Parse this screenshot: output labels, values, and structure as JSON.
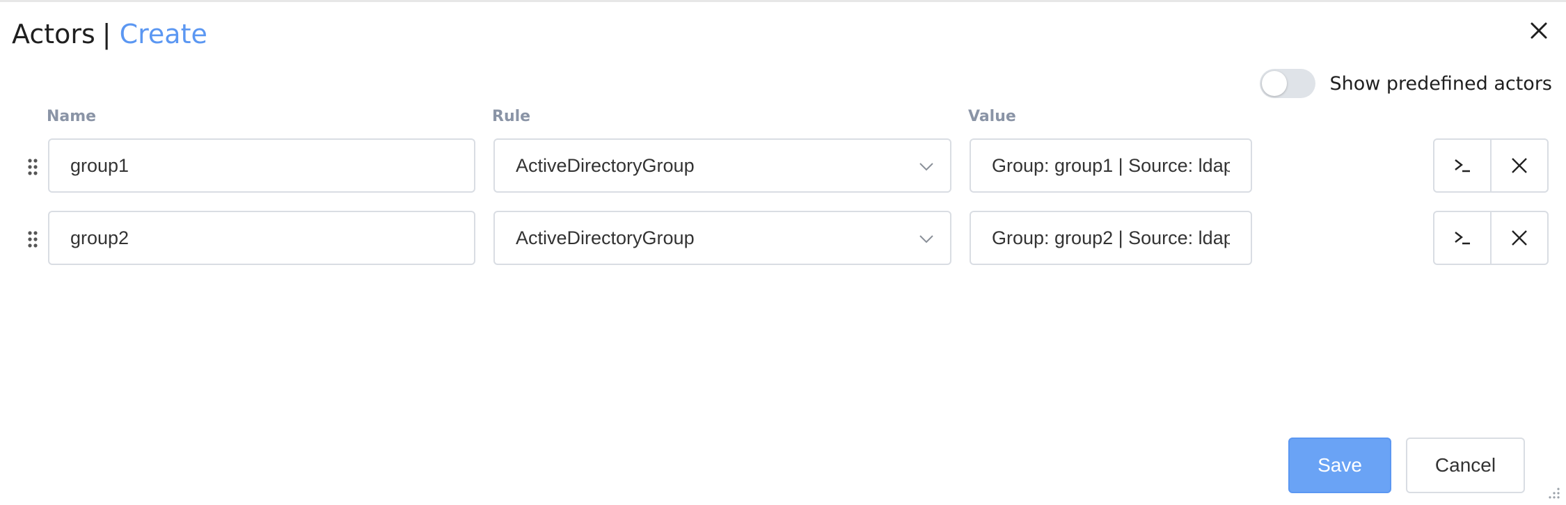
{
  "dialog": {
    "title_main": "Actors",
    "title_separator": "|",
    "title_action": "Create",
    "close_icon": "close-icon"
  },
  "toggle": {
    "label": "Show predefined actors",
    "checked": false
  },
  "columns": {
    "name": "Name",
    "rule": "Rule",
    "value": "Value"
  },
  "rows": [
    {
      "name": "group1",
      "rule": "ActiveDirectoryGroup",
      "value": "Group: group1 | Source: ldap"
    },
    {
      "name": "group2",
      "rule": "ActiveDirectoryGroup",
      "value": "Group: group2 | Source: ldap"
    }
  ],
  "icons": {
    "drag": "drag-handle-icon",
    "chevron": "chevron-down-icon",
    "expression": "terminal-icon",
    "remove": "close-icon"
  },
  "footer": {
    "save_label": "Save",
    "cancel_label": "Cancel"
  },
  "colors": {
    "accent": "#5b97f2",
    "save_bg": "#6aa3f5",
    "header_label": "#8a94a6",
    "border": "#d9dde3"
  }
}
